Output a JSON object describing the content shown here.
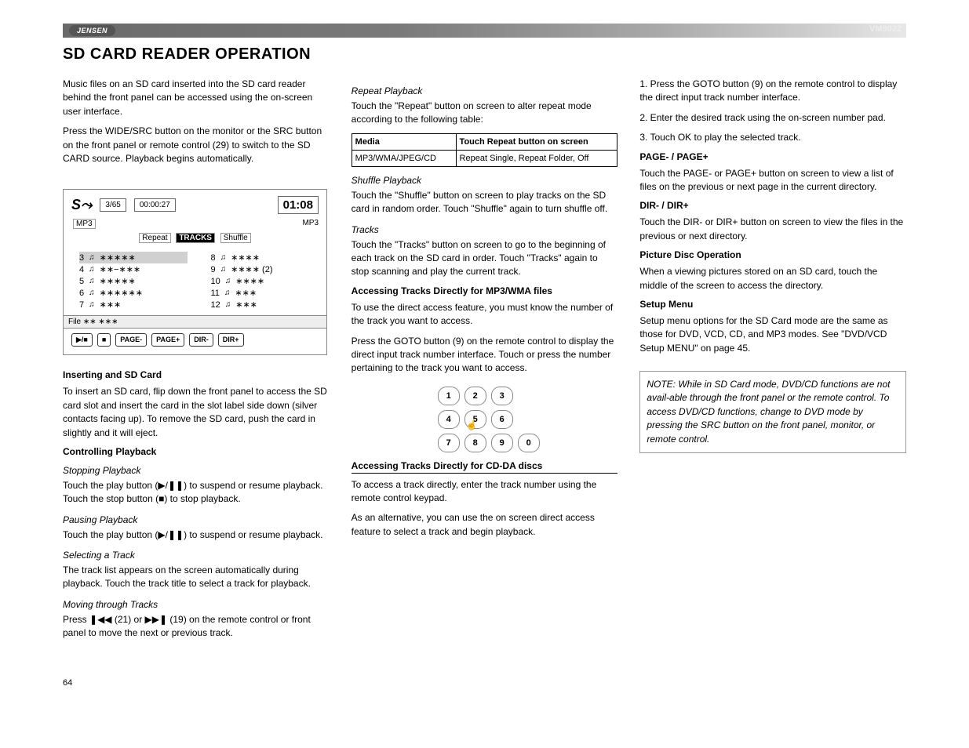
{
  "brand": "JENSEN",
  "model": "VM9022",
  "page_title": "SD CARD READER OPERATION",
  "page_number": "64",
  "col1": {
    "intro_1": "Music files on an SD card inserted into the SD card reader behind the front panel can be accessed using the on-screen user interface.",
    "intro_2": "Press the WIDE/SRC button on the monitor or the SRC button on the front panel or remote control (29) to switch to the SD CARD source. Playback begins automatically.",
    "insert_head": "Inserting and SD Card",
    "insert_body": "To insert an SD card, flip down the front panel to access the SD card slot and insert the card in the slot label side down (silver contacts facing up). To remove the SD card, push the card in slightly and it will eject.",
    "controlling_head": "Controlling Playback",
    "stopping_h": "Stopping Playback",
    "stopping_b": "Touch the play button (▶/❚❚) to suspend or resume playback. Touch the stop button (■) to stop playback.",
    "pausing_h": "Pausing Playback",
    "pausing_b": "Touch the play button (▶/❚❚) to suspend or resume playback.",
    "selecting_h": "Selecting a Track",
    "selecting_b": "The track list appears on the screen automatically during playback. Touch the track title to select a track for playback.",
    "moving_h": "Moving through Tracks",
    "moving_b": "Press  ❚◀◀ (21) or ▶▶❚ (19) on the remote control or front panel to move the next or previous track."
  },
  "col2": {
    "repeat_h": "Repeat Playback",
    "repeat_b": "Touch the \"Repeat\" button on screen to alter repeat mode according to the following table:",
    "table_head_media": "Media",
    "table_head_action": "Touch Repeat button on screen",
    "table_row_label": "MP3/WMA/JPEG/CD",
    "table_row_val": "Repeat Single, Repeat Folder, Off",
    "shuffle_h": "Shuffle Playback",
    "shuffle_b": "Touch the \"Shuffle\" button on screen to play tracks on the SD card in random order. Touch \"Shuffle\" again to turn shuffle off.",
    "tracks_h": "Tracks",
    "tracks_b": "Touch the \"Tracks\" button on screen to go to the beginning of each track on the SD card in order. Touch \"Tracks\" again to stop scanning and play the current track.",
    "mp3_h": "Accessing Tracks Directly for MP3/WMA files",
    "mp3_b1": "To use the direct access feature, you must know the number of the track you want to access.",
    "mp3_b2": "Press the GOTO button (9) on the remote control to display the direct input track number interface. Touch or press the number pertaining to the track you want to access.",
    "cda_head": "Accessing Tracks Directly for CD-DA discs",
    "cda_b1": "To access a track directly, enter the track number using the remote control keypad.",
    "cda_b2": "As an alternative, you can use the on screen direct access feature to select a track and begin playback."
  },
  "col3": {
    "step_1": "1. Press the GOTO button (9) on the remote control to display the direct input track number interface.",
    "step_2": "2. Enter the desired track using the on-screen number pad.",
    "step_3": "3. Touch OK to play the selected track.",
    "page_h": "PAGE- / PAGE+",
    "page_b": "Touch the PAGE- or PAGE+ button on screen to view a list of files on the previous or next page in the current directory.",
    "dir_h": "DIR- / DIR+",
    "dir_b": "Touch the DIR- or DIR+ button on screen to view the files in the previous or next directory.",
    "pic_h": "Picture Disc Operation",
    "pic_b": "When a viewing pictures stored on an SD card, touch the middle of the screen to access the directory.",
    "setup_h": "Setup Menu",
    "setup_b": "Setup menu options for the SD Card mode are the same as those for DVD, VCD, CD, and MP3 modes. See \"DVD/VCD Setup MENU\" on page 45.",
    "note_b": "NOTE: While in SD Card mode, DVD/CD functions are not avail-able through the front panel or the remote control. To access DVD/CD functions, change to DVD mode by pressing the SRC button on the front panel, monitor, or remote control."
  },
  "player": {
    "track_counter": "3/65",
    "elapsed": "00:00:27",
    "total": "01:08",
    "type_left": "MP3",
    "type_right": "MP3",
    "mode_repeat": "Repeat",
    "mode_tracks": "TRACKS",
    "mode_shuffle": "Shuffle",
    "tracks_left": [
      {
        "n": "3",
        "t": "∗∗∗∗∗",
        "sel": true
      },
      {
        "n": "4",
        "t": "∗∗−∗∗∗"
      },
      {
        "n": "5",
        "t": "∗∗∗∗∗"
      },
      {
        "n": "6",
        "t": "∗∗∗∗∗∗"
      },
      {
        "n": "7",
        "t": "∗∗∗"
      }
    ],
    "tracks_right": [
      {
        "n": "8",
        "t": "∗∗∗∗"
      },
      {
        "n": "9",
        "t": "∗∗∗∗ (2)"
      },
      {
        "n": "10",
        "t": "∗∗∗∗"
      },
      {
        "n": "11",
        "t": "∗∗∗"
      },
      {
        "n": "12",
        "t": "∗∗∗"
      }
    ],
    "file_line": "File  ∗∗   ∗∗∗",
    "btn_play": "▶/■",
    "btn_stop": "■",
    "btn_pageminus": "PAGE-",
    "btn_pageplus": "PAGE+",
    "btn_dirminus": "DIR-",
    "btn_dirplus": "DIR+"
  },
  "keypad": {
    "keys": [
      "1",
      "2",
      "3",
      "4",
      "5",
      "6",
      "7",
      "8",
      "9",
      "0"
    ]
  }
}
